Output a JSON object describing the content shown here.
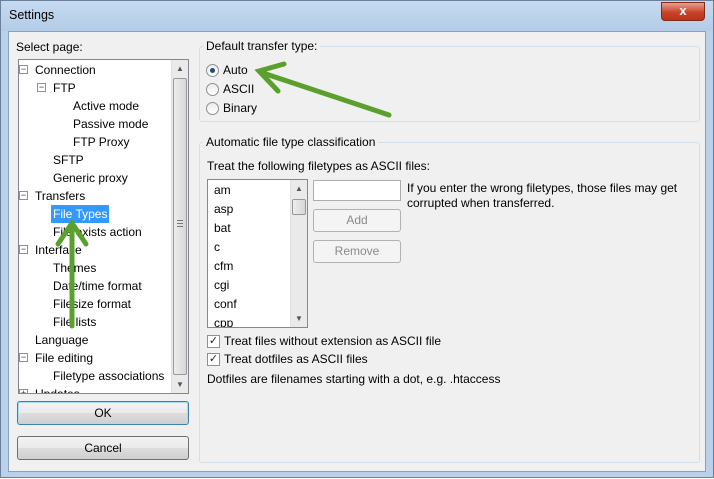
{
  "window": {
    "title": "Settings",
    "close_glyph": "x"
  },
  "left": {
    "select_page_label": "Select page:",
    "tree": [
      {
        "label": "Connection",
        "expander": "−"
      },
      {
        "label": "FTP",
        "expander": "−"
      },
      {
        "label": "Active mode"
      },
      {
        "label": "Passive mode"
      },
      {
        "label": "FTP Proxy"
      },
      {
        "label": "SFTP"
      },
      {
        "label": "Generic proxy"
      },
      {
        "label": "Transfers",
        "expander": "−"
      },
      {
        "label": "File Types",
        "selected": true
      },
      {
        "label": "File exists action"
      },
      {
        "label": "Interface",
        "expander": "−"
      },
      {
        "label": "Themes"
      },
      {
        "label": "Date/time format"
      },
      {
        "label": "Filesize format"
      },
      {
        "label": "File lists"
      },
      {
        "label": "Language"
      },
      {
        "label": "File editing",
        "expander": "−"
      },
      {
        "label": "Filetype associations"
      },
      {
        "label": "Updates",
        "expander": "+"
      }
    ],
    "ok_label": "OK",
    "cancel_label": "Cancel"
  },
  "transfer_type": {
    "group_title": "Default transfer type:",
    "options": [
      {
        "label": "Auto",
        "checked": true
      },
      {
        "label": "ASCII",
        "checked": false
      },
      {
        "label": "Binary",
        "checked": false
      }
    ]
  },
  "classification": {
    "group_title": "Automatic file type classification",
    "list_label": "Treat the following filetypes as ASCII files:",
    "filetypes": [
      "am",
      "asp",
      "bat",
      "c",
      "cfm",
      "cgi",
      "conf",
      "cpp"
    ],
    "new_filetype_value": "",
    "hint_line1": "If you enter the wrong filetypes, those files may get",
    "hint_line2": "corrupted when transferred.",
    "add_label": "Add",
    "remove_label": "Remove",
    "checkbox_no_ext": {
      "label": "Treat files without extension as ASCII file",
      "checked": true
    },
    "checkbox_dotfiles": {
      "label": "Treat dotfiles as ASCII files",
      "checked": true
    },
    "dotfiles_note": "Dotfiles are filenames starting with a dot, e.g. .htaccess"
  },
  "colors": {
    "selection": "#3399ff",
    "annotation_arrow": "#5aa02c",
    "client_bg": "#f0f0f0",
    "frame": "#b9d1ea"
  }
}
